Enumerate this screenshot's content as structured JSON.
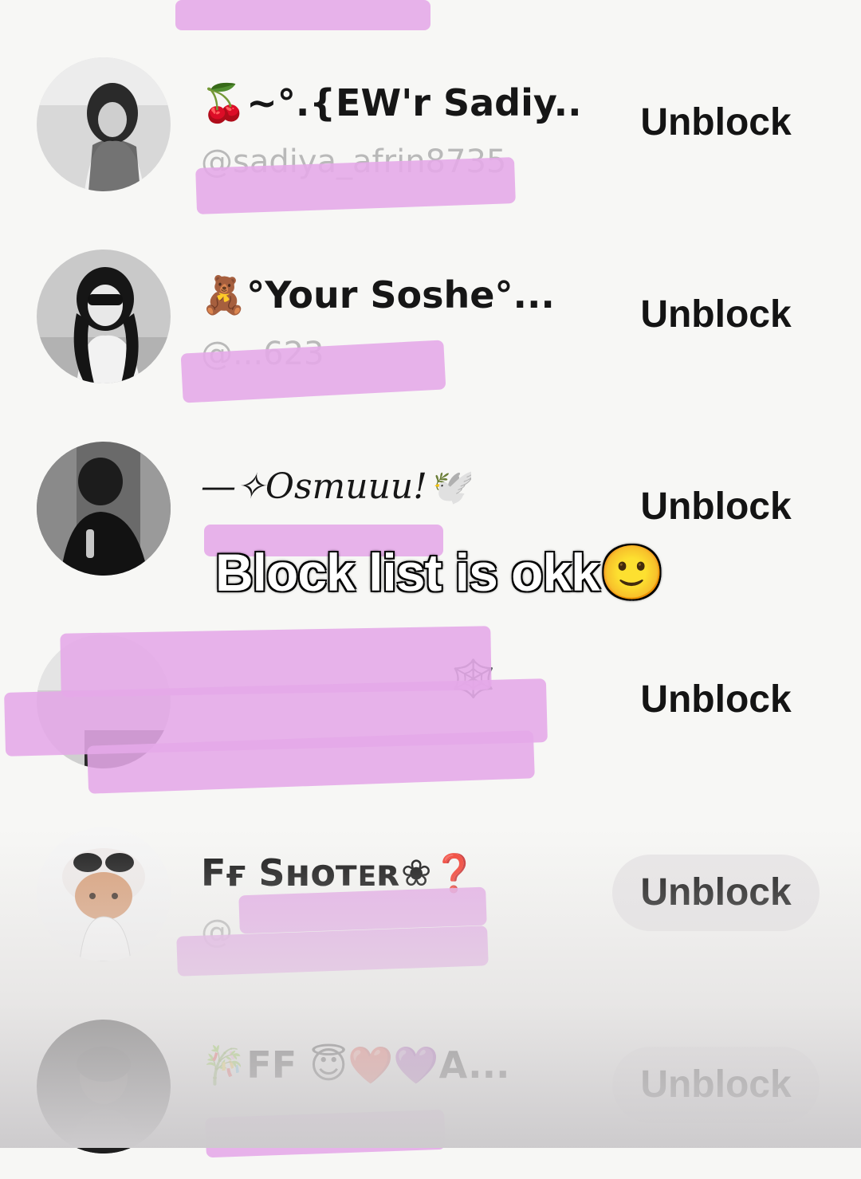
{
  "blocked_list": [
    {
      "name": "🍒~°.{EW'r Sadiy...",
      "handle": "@sadiya_afrin8735",
      "button": "Unblock"
    },
    {
      "name": "🧸°Your Soshe°...",
      "handle": "@...623",
      "button": "Unblock"
    },
    {
      "name": "—✧Osmuuu!🕊️",
      "handle": "",
      "button": "Unblock"
    },
    {
      "name": "🕸️",
      "handle": "",
      "button": "Unblock"
    },
    {
      "name": "Fғ Sʜᴏᴛᴇʀ❀❓",
      "handle": "@",
      "button": "Unblock"
    },
    {
      "name": "🎋FF 😇❤️💜A...",
      "handle": "",
      "button": "Unblock"
    }
  ],
  "overlay": {
    "caption": "Block list is okk🙂"
  },
  "colors": {
    "redaction": "#e5a8e8",
    "button_pill": "#e8e6e7",
    "background": "#f7f7f5"
  }
}
